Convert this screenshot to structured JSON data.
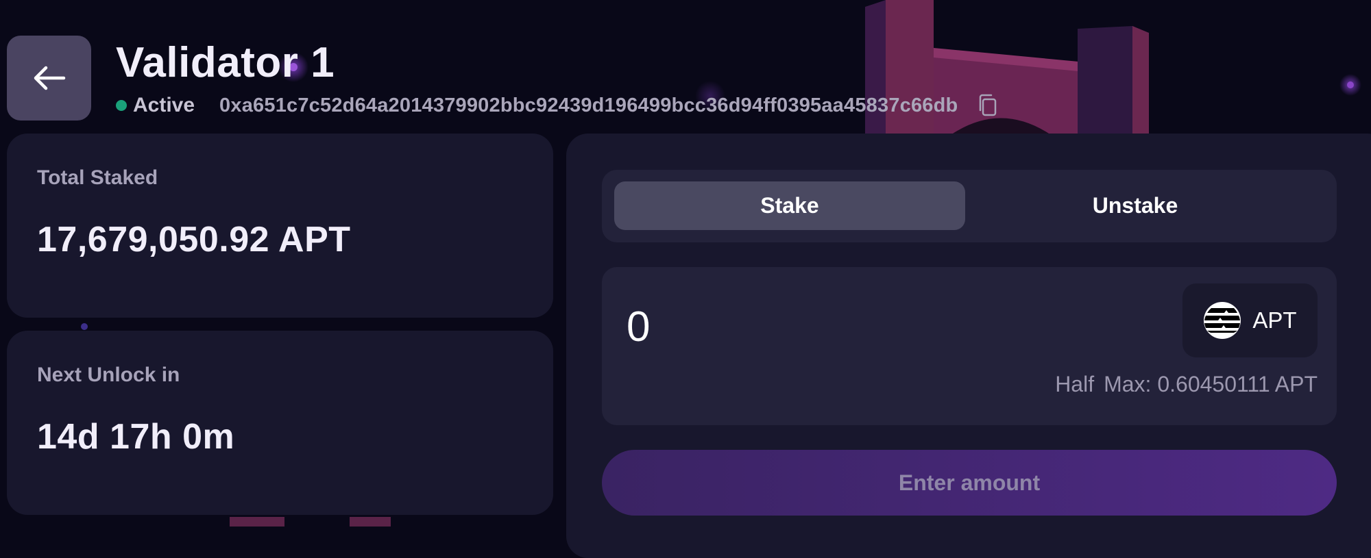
{
  "header": {
    "title": "Validator 1",
    "status": "Active",
    "address": "0xa651c7c52d64a2014379902bbc92439d196499bcc36d94ff0395aa45837c66db"
  },
  "stats": {
    "total_staked": {
      "label": "Total Staked",
      "value": "17,679,050.92 APT"
    },
    "next_unlock": {
      "label": "Next Unlock in",
      "value": "14d 17h 0m"
    }
  },
  "stake_panel": {
    "tabs": [
      {
        "label": "Stake",
        "active": true
      },
      {
        "label": "Unstake",
        "active": false
      }
    ],
    "amount": {
      "value": "0"
    },
    "token": {
      "label": "APT",
      "icon": "aptos-logo-icon"
    },
    "balance": {
      "half_label": "Half",
      "max_label": "Max: 0.60450111 APT"
    },
    "submit_label": "Enter amount"
  },
  "icons": {
    "back": "arrow-left-icon",
    "copy": "copy-icon"
  },
  "colors": {
    "background": "#090818",
    "card": "#18172d",
    "status_active": "#1aa07a",
    "cta_gradient_start": "#3a2363",
    "cta_gradient_end": "#4e2a84"
  }
}
